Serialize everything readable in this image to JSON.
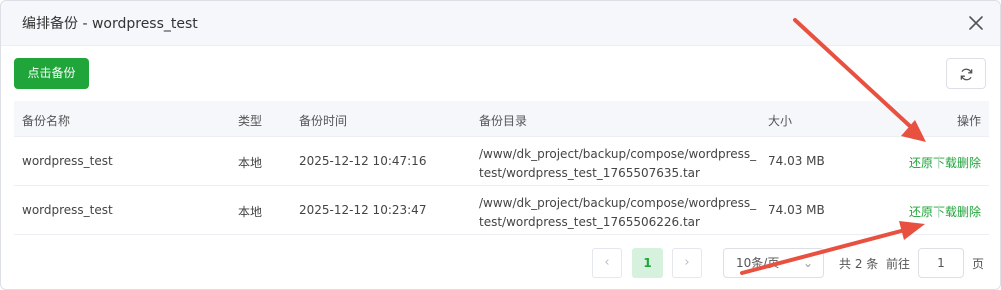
{
  "dialog": {
    "title": "编排备份 - wordpress_test"
  },
  "toolbar": {
    "backup_label": "点击备份",
    "refresh_icon": "refresh-icon"
  },
  "table": {
    "headers": [
      "备份名称",
      "类型",
      "备份时间",
      "备份目录",
      "大小",
      "操作"
    ],
    "rows": [
      {
        "name": "wordpress_test",
        "type": "本地",
        "time": "2025-12-12 10:47:16",
        "dir": "/www/dk_project/backup/compose/wordpress_test/wordpress_test_1765507635.tar",
        "size": "74.03 MB",
        "ops": [
          "还原",
          "下载",
          "删除"
        ]
      },
      {
        "name": "wordpress_test",
        "type": "本地",
        "time": "2025-12-12 10:23:47",
        "dir": "/www/dk_project/backup/compose/wordpress_test/wordpress_test_1765506226.tar",
        "size": "74.03 MB",
        "ops": [
          "还原",
          "下载",
          "删除"
        ]
      }
    ]
  },
  "pagination": {
    "prev": "‹",
    "current": "1",
    "next": "›",
    "page_size": "10条/页",
    "total": "共 2 条",
    "goto_label": "前往",
    "goto_value": "1",
    "page_suffix": "页"
  },
  "colors": {
    "accent": "#20a53a",
    "annotation_arrow": "#e8503f"
  }
}
